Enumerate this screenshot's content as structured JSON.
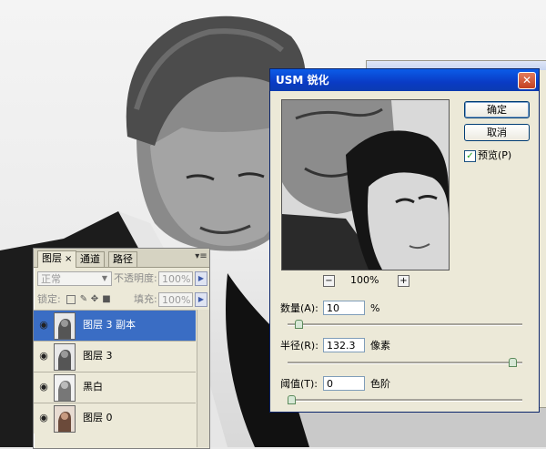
{
  "usm_dialog": {
    "title": "USM 锐化",
    "close_glyph": "✕",
    "ok_label": "确定",
    "cancel_label": "取消",
    "preview_label": "预览(P)",
    "preview_checked": true,
    "zoom_out": "−",
    "zoom_in": "+",
    "zoom_level": "100%",
    "amount_label": "数量(A):",
    "amount_value": "10",
    "amount_unit": "%",
    "amount_slider": 0.03,
    "radius_label": "半径(R):",
    "radius_value": "132.3",
    "radius_unit": "像素",
    "radius_slider": 0.97,
    "threshold_label": "阈值(T):",
    "threshold_value": "0",
    "threshold_unit": "色阶",
    "threshold_slider": 0.0
  },
  "layers_panel": {
    "tabs": [
      {
        "label": "图层",
        "close": "×",
        "active": true
      },
      {
        "label": "通道",
        "active": false
      },
      {
        "label": "路径",
        "active": false
      }
    ],
    "menu_glyph": "▾≡",
    "blend_mode": "正常",
    "opacity_label": "不透明度:",
    "opacity_value": "100%",
    "lock_label": "锁定:",
    "lock_icons": [
      "transparent-lock-icon",
      "brush-lock-icon",
      "move-lock-icon",
      "padlock-icon"
    ],
    "fill_label": "填充:",
    "fill_value": "100%",
    "layers": [
      {
        "name": "图层 3 副本",
        "selected": true
      },
      {
        "name": "图层 3",
        "selected": false
      },
      {
        "name": "黑白",
        "selected": false
      },
      {
        "name": "图层 0",
        "selected": false
      }
    ]
  },
  "colors": {
    "title_bar": "#0a3bc5",
    "selected_layer": "#3a6dc4",
    "dialog_bg": "#ece9d8"
  }
}
